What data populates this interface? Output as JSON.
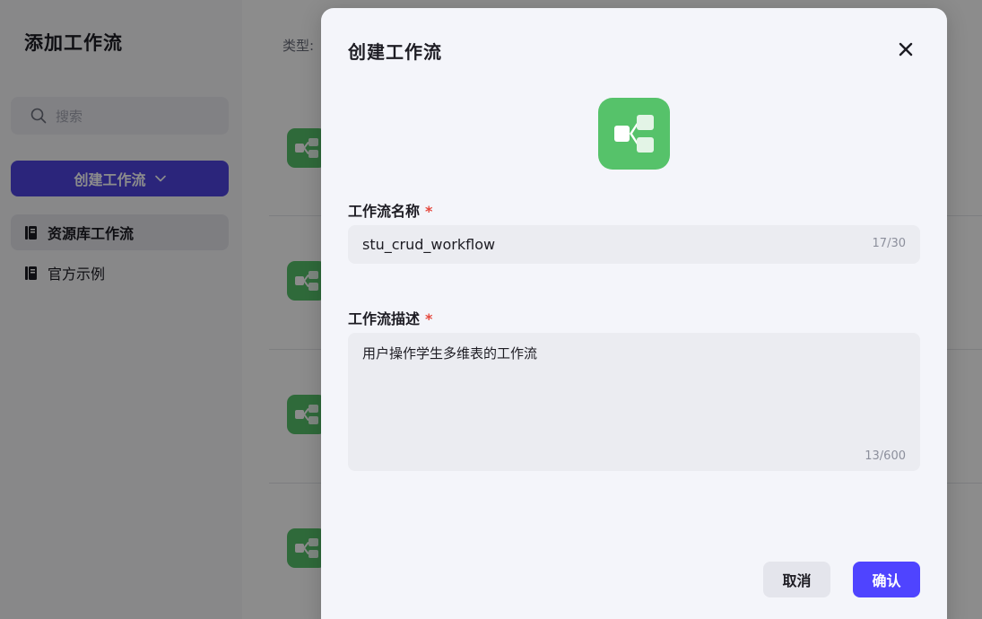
{
  "background": {
    "title": "添加工作流",
    "search_placeholder": "搜索",
    "create_button_label": "创建工作流",
    "nav": [
      {
        "label": "资源库工作流",
        "active": true
      },
      {
        "label": "官方示例",
        "active": false
      }
    ],
    "type_label": "类型:"
  },
  "modal": {
    "title": "创建工作流",
    "name_label": "工作流名称",
    "required_mark": "*",
    "name_value": "stu_crud_workflow",
    "name_counter": "17/30",
    "desc_label": "工作流描述",
    "desc_value": "用户操作学生多维表的工作流",
    "desc_counter": "13/600",
    "cancel_label": "取消",
    "confirm_label": "确认"
  },
  "colors": {
    "accent": "#4f44ff",
    "workflow_icon_bg": "#56c26a",
    "required": "#e5483d"
  },
  "icons": [
    "search-icon",
    "chevron-down-icon",
    "book-icon",
    "workflow-icon",
    "close-icon"
  ]
}
